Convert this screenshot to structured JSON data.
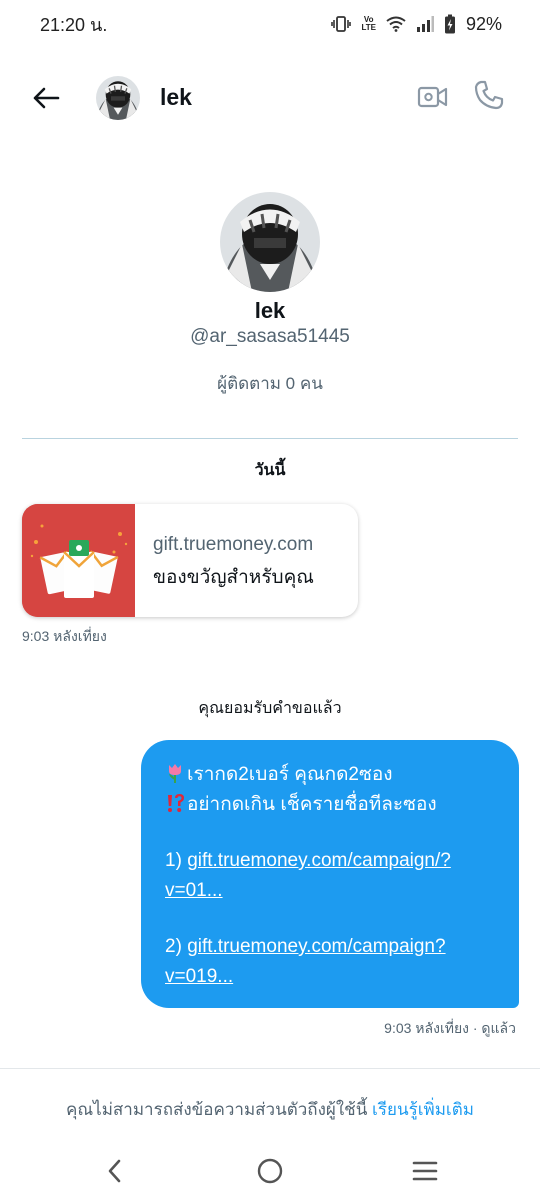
{
  "status_bar": {
    "time": "21:20 น.",
    "volte_top": "Vo",
    "volte_bottom": "LTE",
    "battery": "92%"
  },
  "header": {
    "name": "lek",
    "icons": [
      "back-arrow-icon",
      "video-call-icon",
      "phone-icon"
    ]
  },
  "profile": {
    "name": "lek",
    "handle": "@ar_sasasa51445",
    "followers": "ผู้ติดตาม 0 คน"
  },
  "conversation": {
    "day_label": "วันนี้",
    "received_card": {
      "domain": "gift.truemoney.com",
      "title": "ของขวัญสำหรับคุณ",
      "time": "9:03 หลังเที่ยง"
    },
    "accepted_note": "คุณยอมรับคำขอแล้ว",
    "sent_message": {
      "line1": "เรากด2เบอร์ คุณกด2ซอง",
      "line2": "อย่ากดเกิน เช็ครายชื่อทีละซอง",
      "link1_prefix": "1) ",
      "link1_a": "gift.truemoney.com/campaign/?",
      "link1_b": "v=01...",
      "link2_prefix": "2) ",
      "link2_a": "gift.truemoney.com/campaign?",
      "link2_b": "v=019...",
      "time": "9:03 หลังเที่ยง · ดูแล้ว"
    }
  },
  "notice": {
    "text": "คุณไม่สามารถส่งข้อความส่วนตัวถึงผู้ใช้นี้ ",
    "link": "เรียนรู้เพิ่มเติม"
  },
  "colors": {
    "accent": "#1d9bf0",
    "card_red": "#d64541",
    "secondary_text": "#536471"
  }
}
